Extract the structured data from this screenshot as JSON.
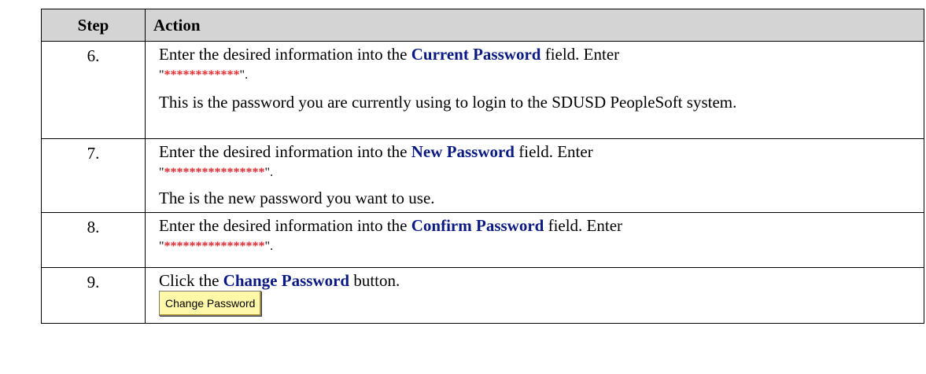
{
  "header": {
    "step": "Step",
    "action": "Action"
  },
  "rows": [
    {
      "step": "6.",
      "pre": "Enter the desired information into the ",
      "field": "Current Password",
      "post": " field. Enter",
      "mask": "************",
      "note": "This is the password you are currently using to login to the SDUSD PeopleSoft system."
    },
    {
      "step": "7.",
      "pre": "Enter the desired information into the ",
      "field": "New Password",
      "post": " field. Enter",
      "mask": "****************",
      "note": "The is the new password you want to use."
    },
    {
      "step": "8.",
      "pre": "Enter the desired information into the ",
      "field": "Confirm Password",
      "post": " field. Enter",
      "mask": "****************"
    },
    {
      "step": "9.",
      "pre": "Click the ",
      "field": "Change Password",
      "post": " button.",
      "button": "Change Password"
    }
  ],
  "punct": {
    "open_quote": "\"",
    "close_quote": "\"."
  },
  "colors": {
    "field": "#0a1a80",
    "mask": "#e0282c",
    "header_bg": "#d4d4d4",
    "button_bg": "#fff8a8"
  }
}
